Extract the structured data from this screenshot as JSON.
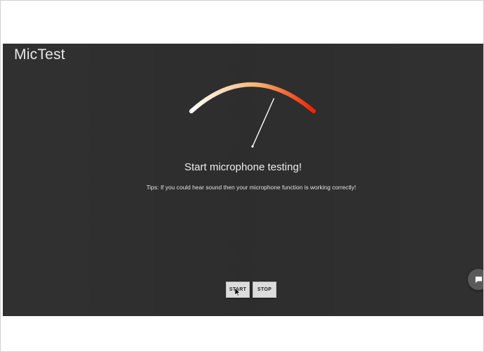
{
  "app": {
    "title": "MicTest"
  },
  "gauge": {
    "level": 0.7,
    "colors": {
      "start": "#ffffff",
      "mid": "#f5b270",
      "end": "#ee2200",
      "needle": "#ffffff"
    }
  },
  "main": {
    "headline": "Start microphone testing!",
    "tips": "Tips: If you could hear sound then your microphone function is working correctly!"
  },
  "controls": {
    "start_label": "START",
    "stop_label": "STOP"
  },
  "floating": {
    "icon": "chat-bubble-icon"
  },
  "colors": {
    "background": "#303030",
    "button": "#dcdcdc"
  }
}
